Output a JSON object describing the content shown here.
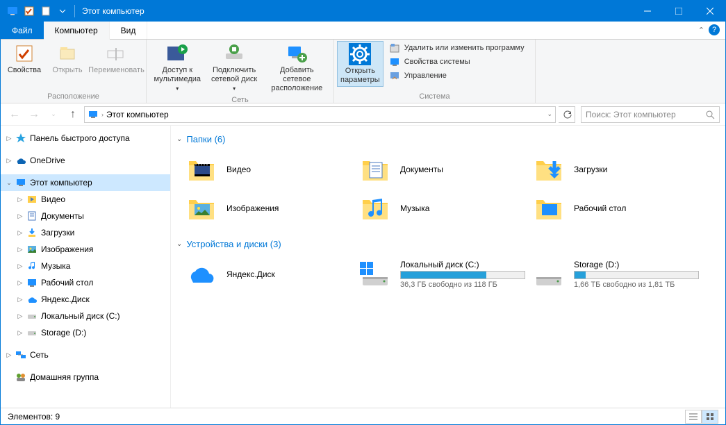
{
  "title": "Этот компьютер",
  "tabs": {
    "file": "Файл",
    "computer": "Компьютер",
    "view": "Вид"
  },
  "ribbon": {
    "location": {
      "label": "Расположение",
      "properties": "Свойства",
      "open": "Открыть",
      "rename": "Переименовать"
    },
    "network": {
      "label": "Сеть",
      "access_line1": "Доступ к",
      "access_line2": "мультимедиа",
      "map_line1": "Подключить",
      "map_line2": "сетевой диск",
      "add_line1": "Добавить сетевое",
      "add_line2": "расположение"
    },
    "system": {
      "label": "Система",
      "open_settings_line1": "Открыть",
      "open_settings_line2": "параметры",
      "uninstall": "Удалить или изменить программу",
      "sysprops": "Свойства системы",
      "manage": "Управление"
    }
  },
  "address": {
    "path": "Этот компьютер"
  },
  "search": {
    "placeholder": "Поиск: Этот компьютер"
  },
  "tree": {
    "quick": "Панель быстрого доступа",
    "onedrive": "OneDrive",
    "thispc": "Этот компьютер",
    "children": [
      "Видео",
      "Документы",
      "Загрузки",
      "Изображения",
      "Музыка",
      "Рабочий стол",
      "Яндекс.Диск",
      "Локальный диск (C:)",
      "Storage (D:)"
    ],
    "network": "Сеть",
    "homegroup": "Домашняя группа"
  },
  "sections": {
    "folders": {
      "title": "Папки (6)",
      "items": [
        "Видео",
        "Документы",
        "Загрузки",
        "Изображения",
        "Музыка",
        "Рабочий стол"
      ]
    },
    "drives": {
      "title": "Устройства и диски (3)",
      "items": [
        {
          "name": "Яндекс.Диск",
          "type": "cloud"
        },
        {
          "name": "Локальный диск (C:)",
          "type": "drive",
          "free": "36,3 ГБ свободно из 118 ГБ",
          "fill": 69
        },
        {
          "name": "Storage (D:)",
          "type": "drive",
          "free": "1,66 ТБ свободно из 1,81 ТБ",
          "fill": 9
        }
      ]
    }
  },
  "status": {
    "text": "Элементов: 9"
  }
}
